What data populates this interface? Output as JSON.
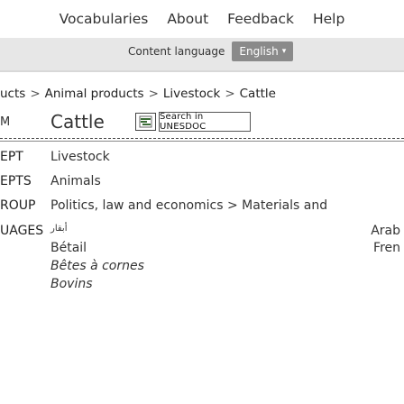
{
  "nav": {
    "items": [
      "Vocabularies",
      "About",
      "Feedback",
      "Help"
    ]
  },
  "language_bar": {
    "label": "Content language",
    "selected": "English"
  },
  "breadcrumb": [
    "ucts",
    "Animal products",
    "Livestock",
    "Cattle"
  ],
  "term": {
    "side_label": "M",
    "title": "Cattle",
    "search_label": "Search in UNESDOC"
  },
  "rows": [
    {
      "side": "EPT",
      "value": "Livestock"
    },
    {
      "side": "EPTS",
      "value": "Animals"
    },
    {
      "side": "ROUP",
      "value": "Politics, law and economics > Materials and"
    },
    {
      "side": "UAGES",
      "value": "أبقار",
      "right": "Arab"
    },
    {
      "side": "",
      "value": "Bétail",
      "right": "Fren"
    },
    {
      "side": "",
      "value": "Bêtes à cornes"
    },
    {
      "side": "",
      "value": "Bovins"
    }
  ],
  "colors": {
    "language_bar_bg": "#e7e7e7",
    "language_select_bg": "#8a8a8a"
  },
  "icons": {
    "database": "database-icon",
    "caret": "chevron-down-icon"
  }
}
